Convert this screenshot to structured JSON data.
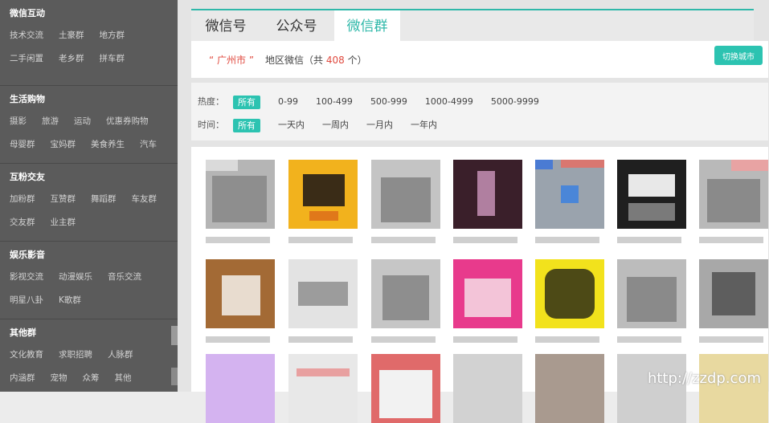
{
  "sidebar": {
    "sections": [
      {
        "title": "微信互动",
        "rows": [
          [
            "技术交流",
            "土豪群",
            "地方群"
          ],
          [
            "二手闲置",
            "老乡群",
            "拼车群"
          ]
        ]
      },
      {
        "title": "生活购物",
        "rows": [
          [
            "摄影",
            "旅游",
            "运动",
            "优惠券购物"
          ],
          [
            "母婴群",
            "宝妈群",
            "美食养生",
            "汽车"
          ]
        ]
      },
      {
        "title": "互粉交友",
        "rows": [
          [
            "加粉群",
            "互赞群",
            "舞蹈群",
            "车友群"
          ],
          [
            "交友群",
            "业主群"
          ]
        ]
      },
      {
        "title": "娱乐影音",
        "rows": [
          [
            "影视交流",
            "动漫娱乐",
            "音乐交流"
          ],
          [
            "明星八卦",
            "K歌群"
          ]
        ]
      },
      {
        "title": "其他群",
        "rows": [
          [
            "文化教育",
            "求职招聘",
            "人脉群"
          ],
          [
            "内涵群",
            "宠物",
            "众筹",
            "其他"
          ]
        ]
      }
    ]
  },
  "tabs": [
    {
      "label": "微信号",
      "active": false
    },
    {
      "label": "公众号",
      "active": false
    },
    {
      "label": "微信群",
      "active": true
    }
  ],
  "city": {
    "name": "“ 广州市 ”",
    "prefix": "地区微信（共",
    "count": "408",
    "suffix": "个）",
    "switch_label": "切换城市"
  },
  "filters": {
    "heat": {
      "label": "热度：",
      "options": [
        "所有",
        "0-99",
        "100-499",
        "500-999",
        "1000-4999",
        "5000-9999"
      ],
      "selected": 0
    },
    "time": {
      "label": "时间：",
      "options": [
        "所有",
        "一天内",
        "一周内",
        "一月内",
        "一年内"
      ],
      "selected": 0
    }
  },
  "colors": {
    "accent": "#2cc3b1",
    "highlight": "#e04a3f"
  },
  "watermark": "http://zzdp.com"
}
